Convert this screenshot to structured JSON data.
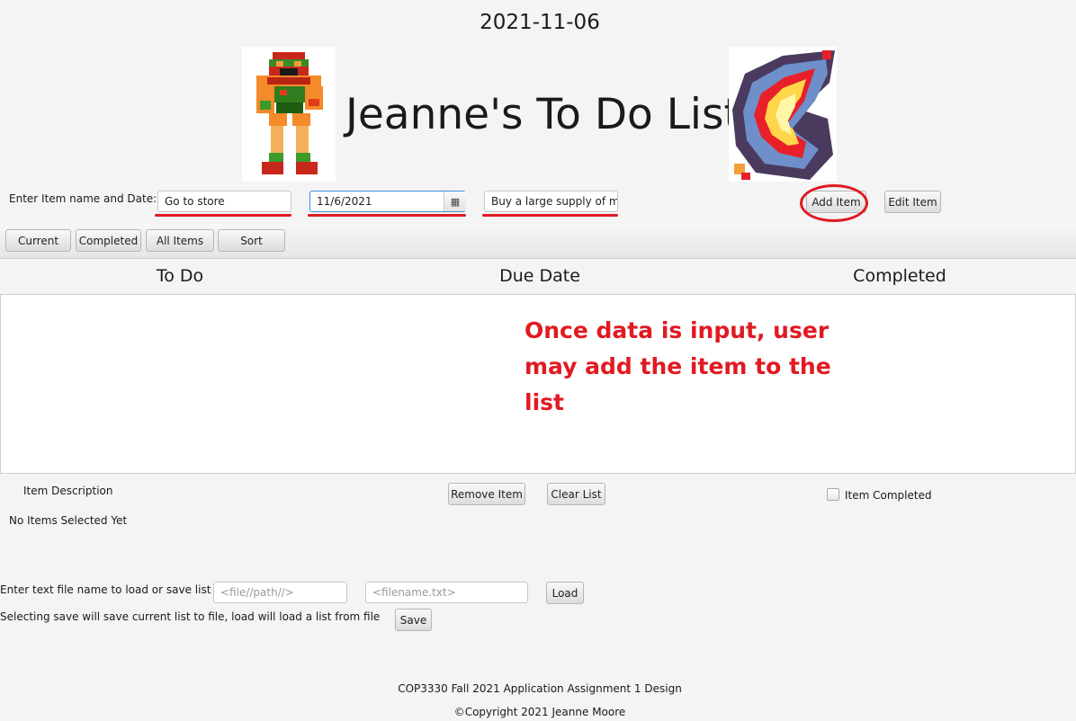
{
  "header": {
    "date": "2021-11-06",
    "title": "Jeanne's To Do List",
    "left_image": "samus-pixel-sprite",
    "right_image": "pixel-fireball-sprite"
  },
  "entry": {
    "label": "Enter Item name and Date:",
    "name_value": "Go to store",
    "date_value": "11/6/2021",
    "description_value": "Buy a large supply of milk",
    "add_label": "Add Item",
    "edit_label": "Edit Item",
    "calendar_icon": "calendar-icon"
  },
  "toolbar": {
    "current": "Current",
    "completed": "Completed",
    "all_items": "All Items",
    "sort": "Sort"
  },
  "table": {
    "columns": [
      "To Do",
      "Due Date",
      "Completed"
    ],
    "rows": []
  },
  "annotation": {
    "text": "Once data is input, user may add the item to the list",
    "color": "#e01a22"
  },
  "details": {
    "description_label": "Item Description",
    "selection_status": "No Items Selected Yet",
    "remove_label": "Remove Item",
    "clear_label": "Clear List",
    "completed_checkbox_label": "Item Completed",
    "completed_checked": false
  },
  "file": {
    "prompt": "Enter text file name to load or save list to",
    "path_placeholder": "<file//path//>",
    "filename_placeholder": "<filename.txt>",
    "load_label": "Load",
    "save_label": "Save",
    "hint": "Selecting save will save current list to file, load will load a list from file"
  },
  "footer": {
    "line1": "COP3330 Fall 2021 Application Assignment 1 Design",
    "line2": "©Copyright 2021 Jeanne Moore"
  }
}
